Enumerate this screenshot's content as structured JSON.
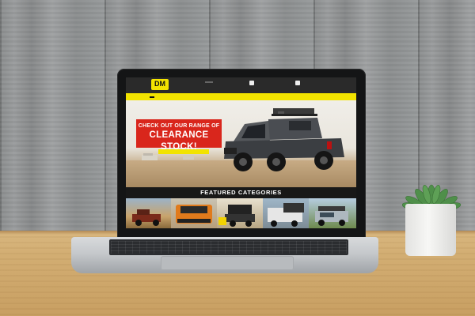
{
  "site": {
    "logo_text": "DM",
    "logo_subtext": "",
    "contacts": [
      {
        "label": "",
        "number": ""
      },
      {
        "label": "",
        "number": ""
      }
    ],
    "nav": [
      {
        "label": ""
      },
      {
        "label": ""
      },
      {
        "label": ""
      },
      {
        "label": ""
      },
      {
        "label": ""
      },
      {
        "label": ""
      },
      {
        "label": ""
      },
      {
        "label": ""
      },
      {
        "label": ""
      }
    ],
    "hero": {
      "promo_line1": "CHECK OUT OUR RANGE OF",
      "promo_line2": "CLEARANCE STOCK!",
      "cta": ""
    },
    "featured_title": "FEATURED CATEGORIES",
    "category_thumbs": [
      {
        "icon": "desert-ute-photo"
      },
      {
        "icon": "orange-ute-photo"
      },
      {
        "icon": "rooftop-tent-photo"
      },
      {
        "icon": "canopy-ute-photo"
      },
      {
        "icon": "camp-ute-photo"
      }
    ]
  },
  "colors": {
    "brand_yellow": "#f2e300",
    "promo_red": "#d9261c",
    "header_dark": "#2a2a2a"
  }
}
